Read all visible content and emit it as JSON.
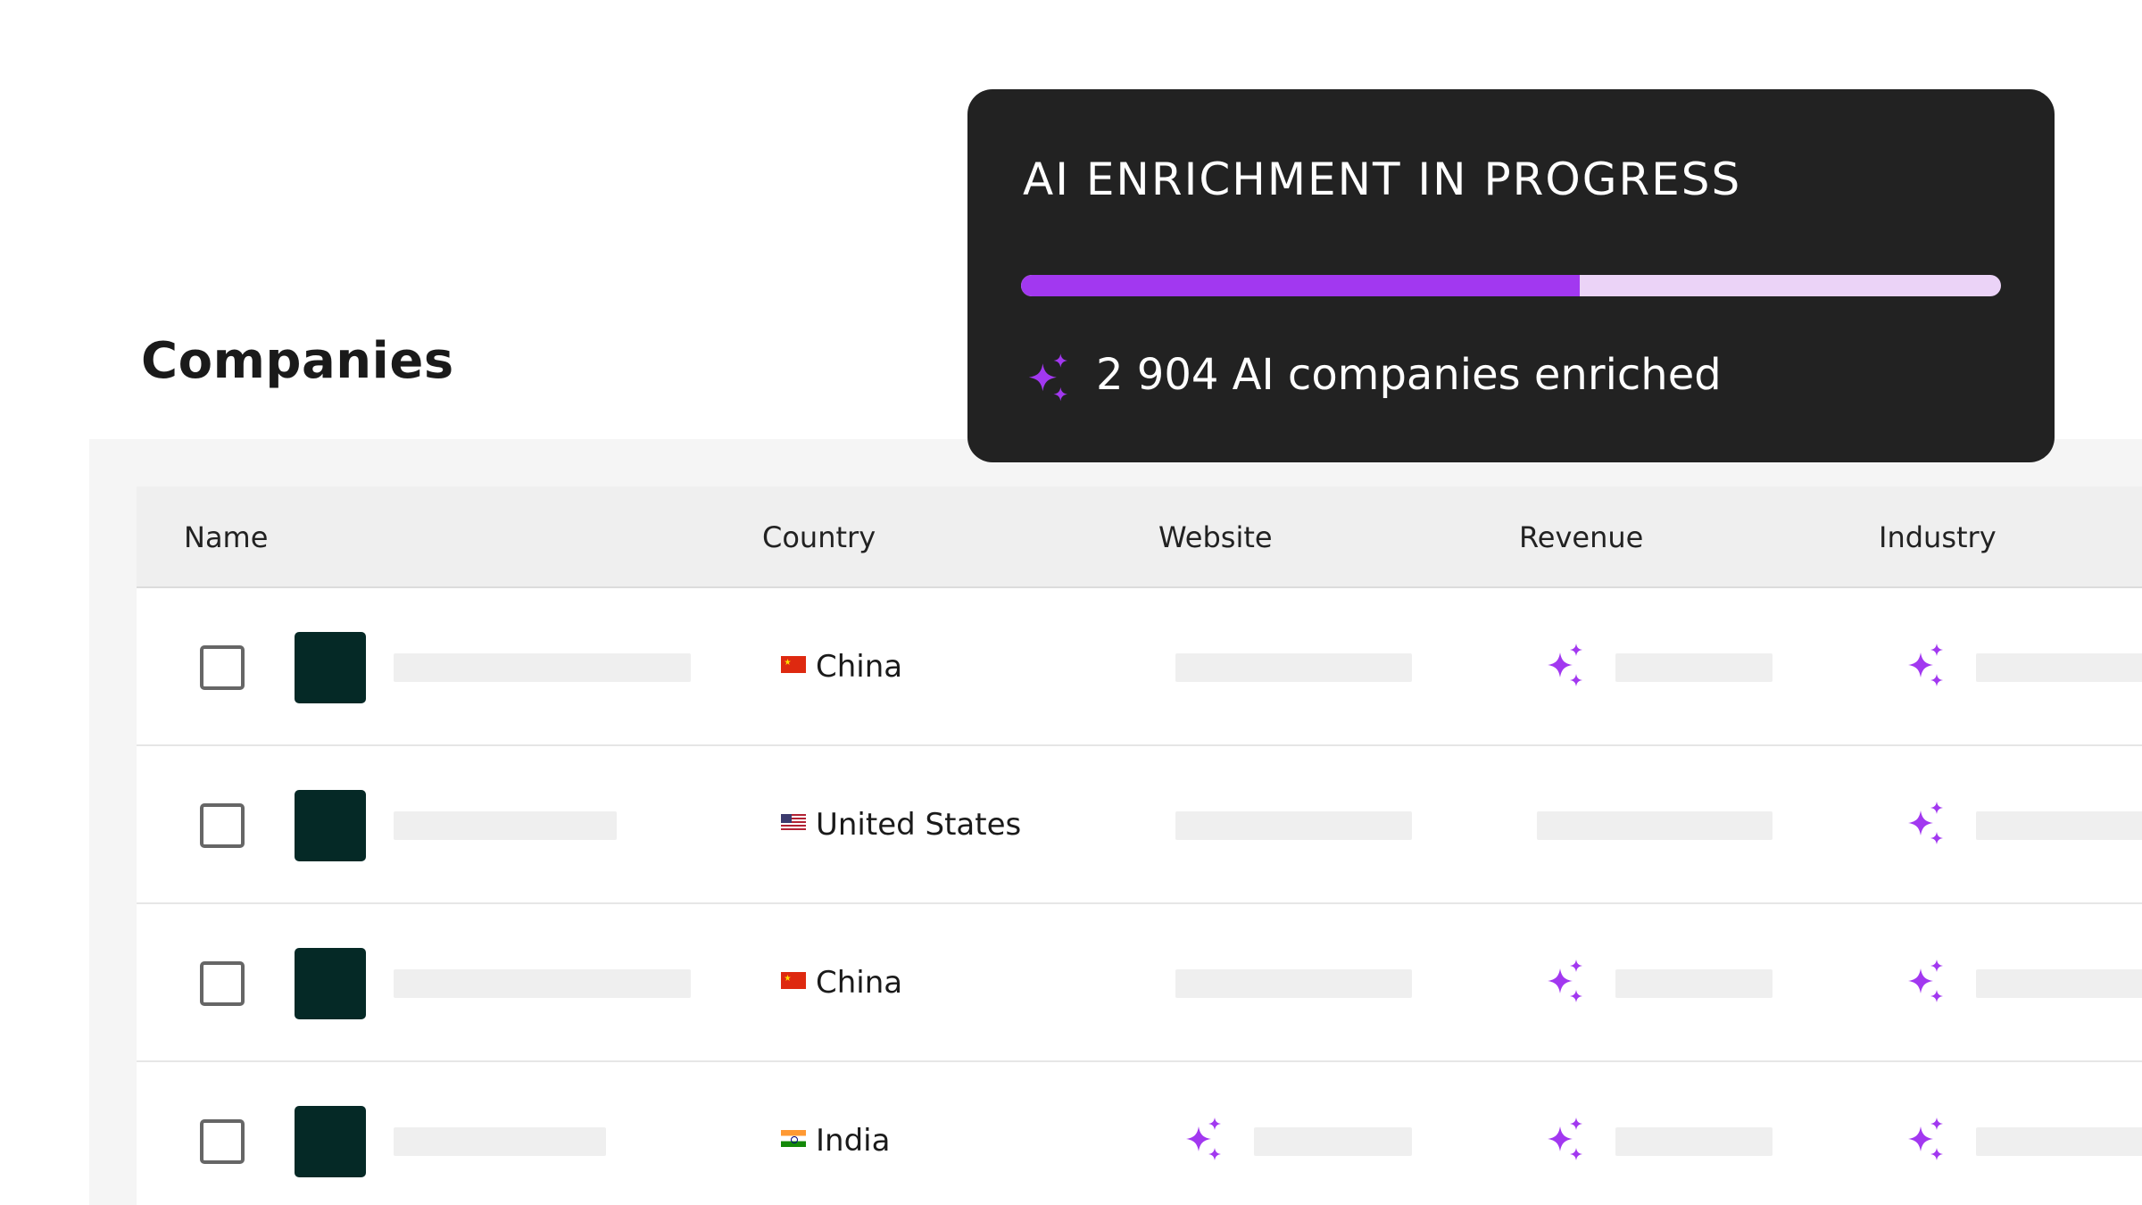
{
  "page": {
    "title": "Companies"
  },
  "table": {
    "columns": [
      "Name",
      "Country",
      "Website",
      "Revenue",
      "Industry"
    ],
    "rows": [
      {
        "country": "China"
      },
      {
        "country": "United States"
      },
      {
        "country": "China"
      },
      {
        "country": "India"
      }
    ]
  },
  "enrichment": {
    "title": "AI ENRICHMENT IN PROGRESS",
    "progress_fraction": 0.57,
    "status_text": "2 904 AI companies enriched"
  },
  "icons": {
    "row_selector": "checkbox-icon",
    "company_logo": "company-logo",
    "ai_marker": "sparkle-icon",
    "flags": [
      "china-flag-icon",
      "united-states-flag-icon",
      "china-flag-icon",
      "india-flag-icon"
    ]
  },
  "colors": {
    "accent_purple": "#a238f0",
    "progress_track": "#ebd3f7",
    "popup_background": "#222222",
    "logo_green": "#052926",
    "placeholder_gray": "#efefef",
    "header_background": "#efefef"
  }
}
